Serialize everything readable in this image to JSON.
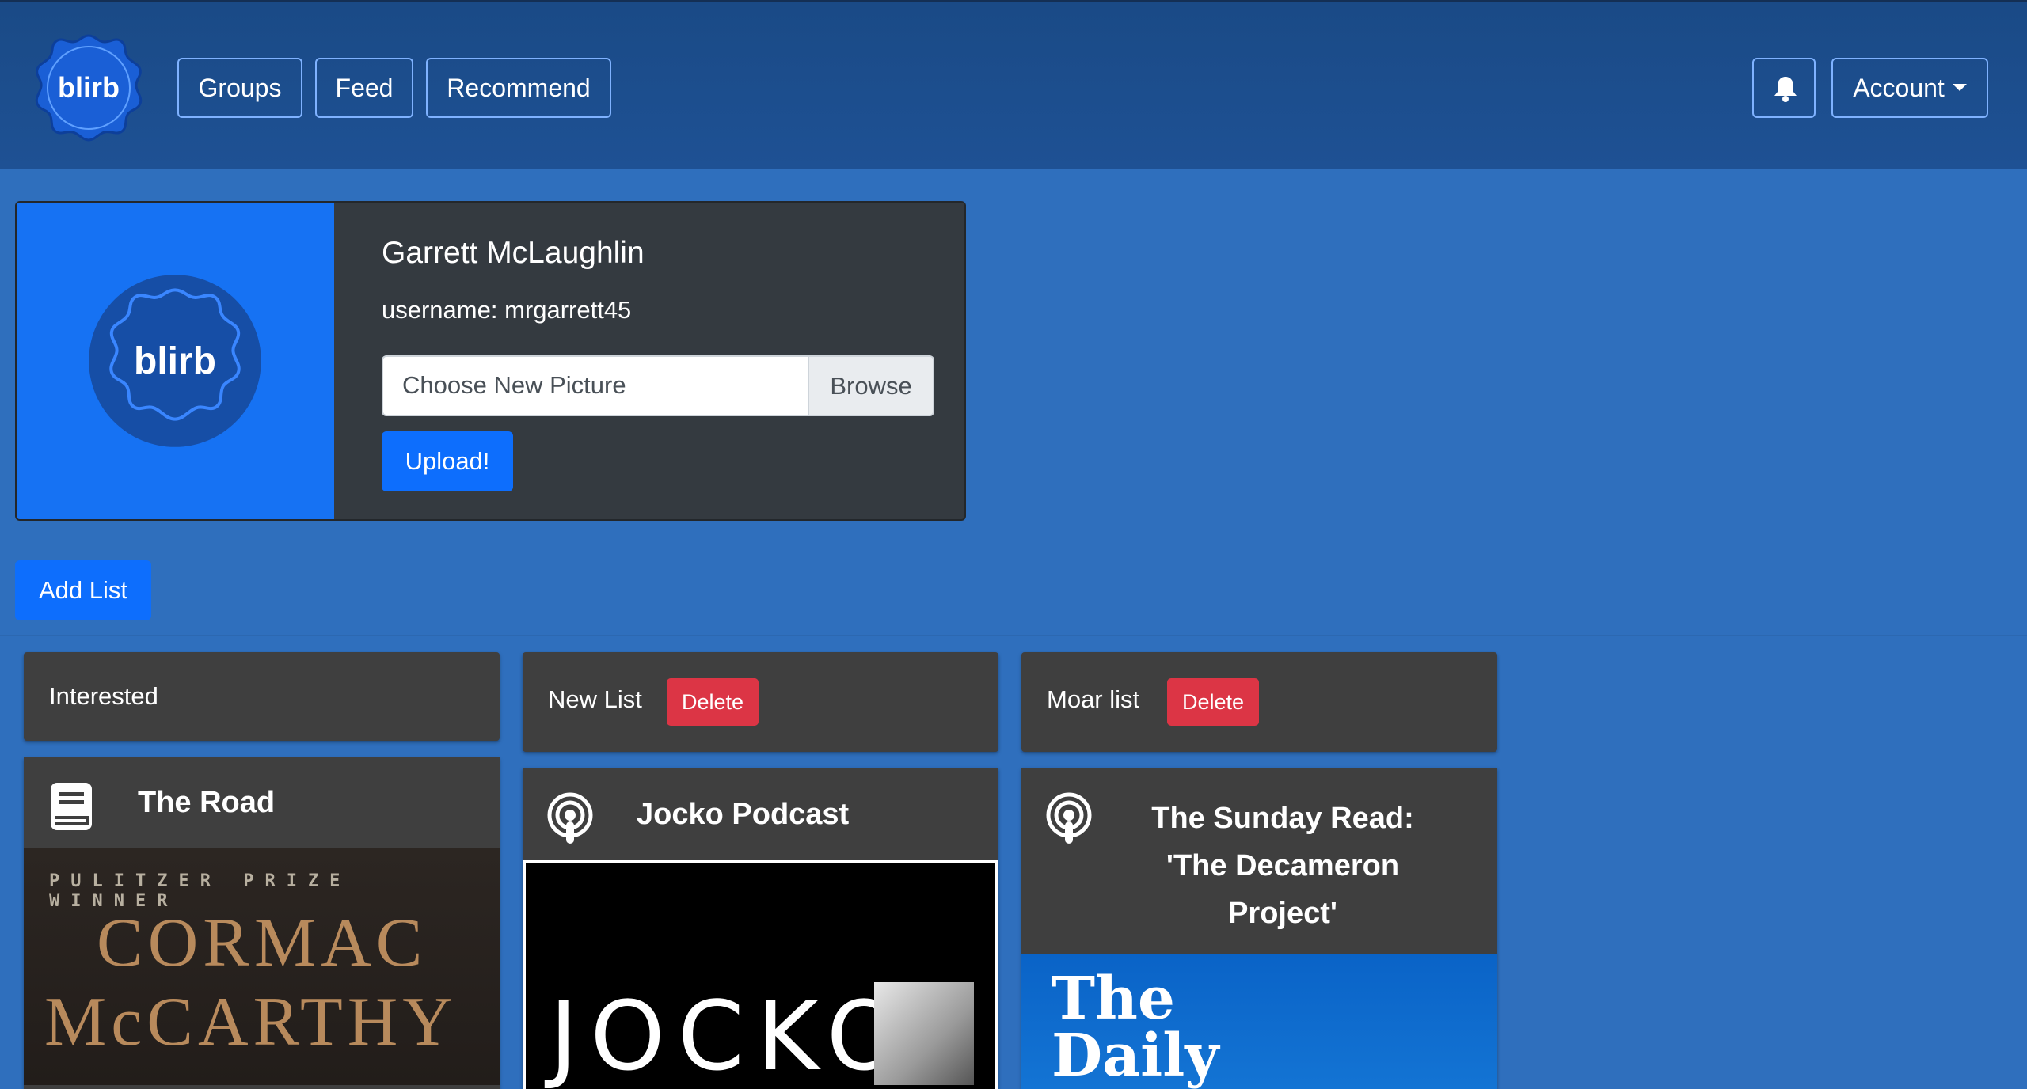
{
  "brand": {
    "logo_text": "blirb"
  },
  "nav": {
    "groups": "Groups",
    "feed": "Feed",
    "recommend": "Recommend",
    "bell_icon": "bell-icon",
    "account": "Account"
  },
  "profile": {
    "name": "Garrett McLaughlin",
    "username": "username: mrgarrett45",
    "file_placeholder": "Choose New Picture",
    "browse": "Browse",
    "upload": "Upload!",
    "avatar_text": "blirb"
  },
  "add_list": "Add List",
  "lists": [
    {
      "title": "Interested",
      "delete": null,
      "items": [
        {
          "type": "book",
          "icon": "book-icon",
          "title": "The Road",
          "cover_text": [
            "PULITZER PRIZE WINNER",
            "CORMAC",
            "McCARTHY"
          ]
        }
      ]
    },
    {
      "title": "New List",
      "delete": "Delete",
      "items": [
        {
          "type": "podcast",
          "icon": "podcast-icon",
          "title": "Jocko Podcast",
          "cover_text": [
            "JOCKO"
          ]
        }
      ]
    },
    {
      "title": "Moar list",
      "delete": "Delete",
      "items": [
        {
          "type": "podcast",
          "icon": "podcast-icon",
          "title_lines": [
            "The Sunday Read:",
            "'The Decameron",
            "Project'"
          ],
          "cover_text": [
            "The",
            "Daily"
          ]
        }
      ]
    }
  ],
  "colors": {
    "page_bg": "#2f6fbd",
    "navbar_bg": "#1e5194",
    "card_bg": "#343a40",
    "list_bg": "#3f3f3f",
    "primary": "#0d6efd",
    "danger": "#dc3545"
  }
}
